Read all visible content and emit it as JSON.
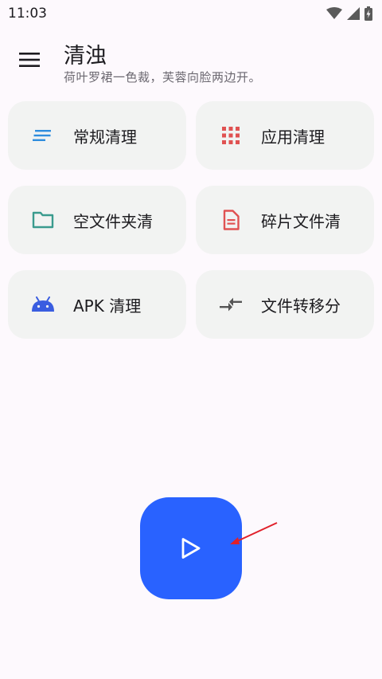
{
  "status_bar": {
    "time": "11:03"
  },
  "header": {
    "title": "清浊",
    "subtitle": "荷叶罗裙一色裁，芙蓉向脸两边开。"
  },
  "cards": [
    {
      "label": "常规清理",
      "icon": "short-text-icon",
      "color": "#2f8dde"
    },
    {
      "label": "应用清理",
      "icon": "apps-grid-icon",
      "color": "#e05252"
    },
    {
      "label": "空文件夹清",
      "icon": "folder-icon",
      "color": "#3a9b8e"
    },
    {
      "label": "碎片文件清",
      "icon": "document-icon",
      "color": "#e05252"
    },
    {
      "label": "APK 清理",
      "icon": "android-icon",
      "color": "#3a5de0"
    },
    {
      "label": "文件转移分",
      "icon": "compare-arrows-icon",
      "color": "#555555"
    }
  ],
  "fab": {
    "icon": "play-icon",
    "color": "#2962ff"
  },
  "annotation": {
    "icon": "arrow-icon",
    "color": "#e0202a"
  }
}
